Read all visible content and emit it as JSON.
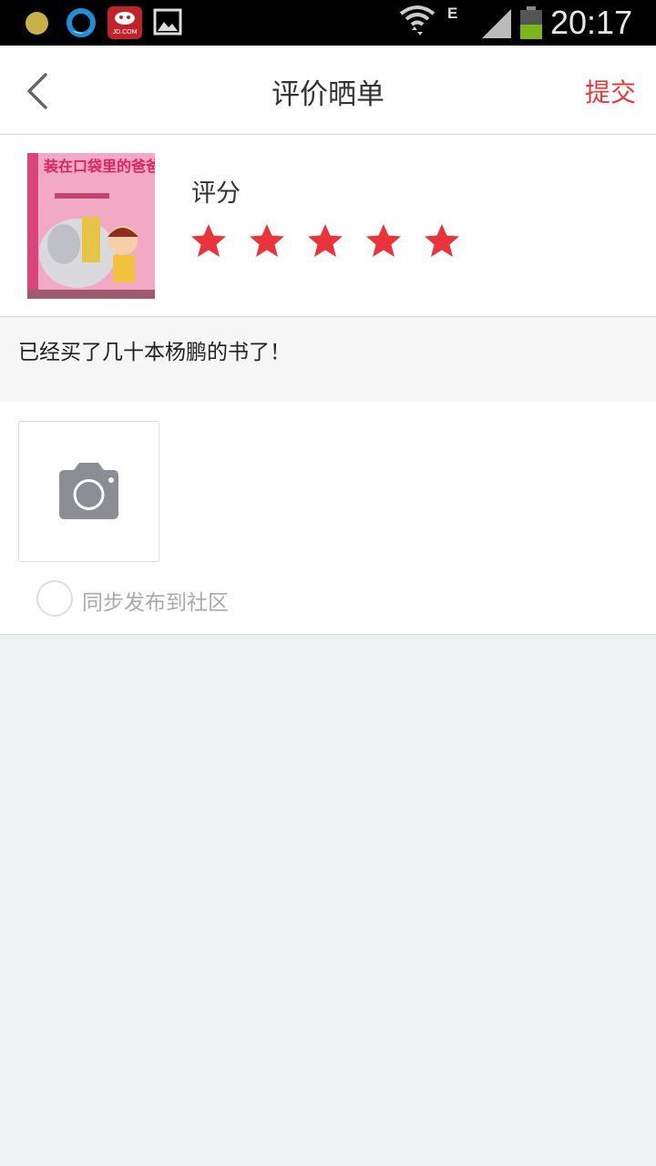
{
  "status_bar": {
    "time": "20:17",
    "network_type": "E",
    "app_badge_text": "JD.COM",
    "icons": [
      "notification-dot-icon",
      "browser-q-icon",
      "jd-app-icon",
      "gallery-icon",
      "wifi-icon",
      "signal-icon",
      "battery-icon"
    ],
    "colors": {
      "background": "#000000",
      "battery_level": "#7bb61b"
    }
  },
  "header": {
    "title": "评价晒单",
    "submit_label": "提交",
    "back_icon": "chevron-left-icon",
    "colors": {
      "accent": "#e4393c"
    }
  },
  "product": {
    "cover_text": "装在口袋里的爸爸",
    "rating_label": "评分",
    "rating_value": 5,
    "rating_max": 5,
    "star_color": "#e8343a"
  },
  "review": {
    "text": "已经买了几十本杨鹏的书了！"
  },
  "photos": {
    "add_photo_icon": "camera-icon",
    "sync_label": "同步发布到社区",
    "sync_checked": false
  }
}
